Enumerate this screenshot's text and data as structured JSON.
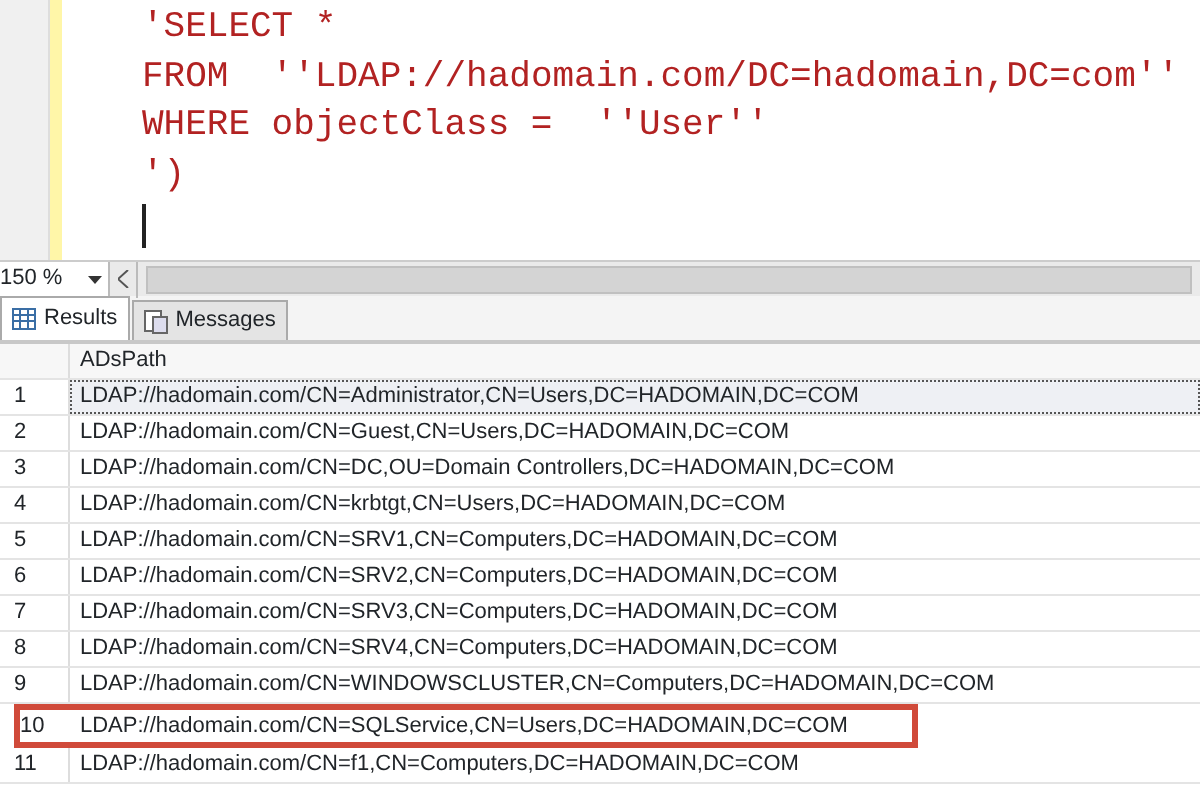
{
  "editor": {
    "lines": [
      {
        "text": "'SELECT *"
      },
      {
        "text": "FROM  ''",
        "link": "LDAP://hadomain.com/DC=hadomain,DC=com",
        "after": "''"
      },
      {
        "text": "WHERE objectClass =  ''User''"
      },
      {
        "text": "')"
      }
    ]
  },
  "zoom": {
    "value": "150 %"
  },
  "tabs": [
    {
      "label": "Results",
      "selected": true
    },
    {
      "label": "Messages",
      "selected": false
    }
  ],
  "table": {
    "columns": [
      "ADsPath"
    ],
    "rows": [
      {
        "num": "1",
        "path": "LDAP://hadomain.com/CN=Administrator,CN=Users,DC=HADOMAIN,DC=COM",
        "selected": true,
        "highlighted": false
      },
      {
        "num": "2",
        "path": "LDAP://hadomain.com/CN=Guest,CN=Users,DC=HADOMAIN,DC=COM",
        "selected": false,
        "highlighted": false
      },
      {
        "num": "3",
        "path": "LDAP://hadomain.com/CN=DC,OU=Domain Controllers,DC=HADOMAIN,DC=COM",
        "selected": false,
        "highlighted": false
      },
      {
        "num": "4",
        "path": "LDAP://hadomain.com/CN=krbtgt,CN=Users,DC=HADOMAIN,DC=COM",
        "selected": false,
        "highlighted": false
      },
      {
        "num": "5",
        "path": "LDAP://hadomain.com/CN=SRV1,CN=Computers,DC=HADOMAIN,DC=COM",
        "selected": false,
        "highlighted": false
      },
      {
        "num": "6",
        "path": "LDAP://hadomain.com/CN=SRV2,CN=Computers,DC=HADOMAIN,DC=COM",
        "selected": false,
        "highlighted": false
      },
      {
        "num": "7",
        "path": "LDAP://hadomain.com/CN=SRV3,CN=Computers,DC=HADOMAIN,DC=COM",
        "selected": false,
        "highlighted": false
      },
      {
        "num": "8",
        "path": "LDAP://hadomain.com/CN=SRV4,CN=Computers,DC=HADOMAIN,DC=COM",
        "selected": false,
        "highlighted": false
      },
      {
        "num": "9",
        "path": "LDAP://hadomain.com/CN=WINDOWSCLUSTER,CN=Computers,DC=HADOMAIN,DC=COM",
        "selected": false,
        "highlighted": false
      },
      {
        "num": "10",
        "path": "LDAP://hadomain.com/CN=SQLService,CN=Users,DC=HADOMAIN,DC=COM",
        "selected": false,
        "highlighted": true
      },
      {
        "num": "11",
        "path": "LDAP://hadomain.com/CN=f1,CN=Computers,DC=HADOMAIN,DC=COM",
        "selected": false,
        "highlighted": false
      }
    ]
  }
}
